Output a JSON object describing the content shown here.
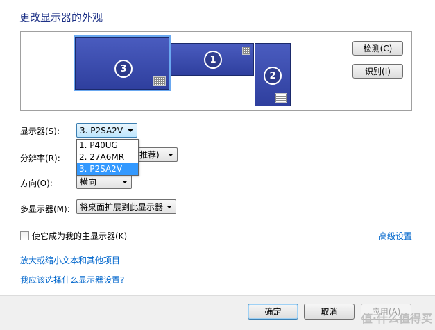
{
  "window": {
    "title": "更改显示器的外观"
  },
  "monitors": [
    {
      "number": "3"
    },
    {
      "number": "1"
    },
    {
      "number": "2"
    }
  ],
  "buttons": {
    "detect": "检测(C)",
    "identify": "识别(I)",
    "ok": "确定",
    "cancel": "取消",
    "apply": "应用(A)"
  },
  "form": {
    "display_label": "显示器(S):",
    "display_value": "3. P2SA2V",
    "display_options": [
      "1. P40UG",
      "2. 27A6MR",
      "3. P2SA2V"
    ],
    "resolution_label": "分辨率(R):",
    "resolution_value_visible": "推荐)",
    "orientation_label": "方向(O):",
    "orientation_value": "横向",
    "multi_label": "多显示器(M):",
    "multi_value": "将桌面扩展到此显示器",
    "primary_checkbox_label": "使它成为我的主显示器(K)",
    "primary_checked": false
  },
  "links": {
    "advanced": "高级设置",
    "text_size": "放大或缩小文本和其他项目",
    "which_settings": "我应该选择什么显示器设置?"
  },
  "watermark": "值·什么值得买"
}
